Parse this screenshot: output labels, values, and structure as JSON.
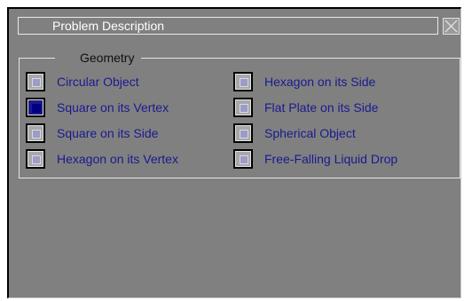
{
  "window": {
    "title": "Problem Description"
  },
  "geometry": {
    "legend": "Geometry",
    "options": [
      {
        "label": "Circular Object",
        "checked": false
      },
      {
        "label": "Square on its Vertex",
        "checked": true
      },
      {
        "label": "Square on its Side",
        "checked": false
      },
      {
        "label": "Hexagon on its Vertex",
        "checked": false
      },
      {
        "label": "Hexagon on its Side",
        "checked": false
      },
      {
        "label": "Flat Plate on its Side",
        "checked": false
      },
      {
        "label": "Spherical Object",
        "checked": false
      },
      {
        "label": "Free-Falling Liquid Drop",
        "checked": false
      }
    ]
  },
  "colors": {
    "background": "#808080",
    "label": "#1a1a90",
    "checked": "#000080"
  }
}
